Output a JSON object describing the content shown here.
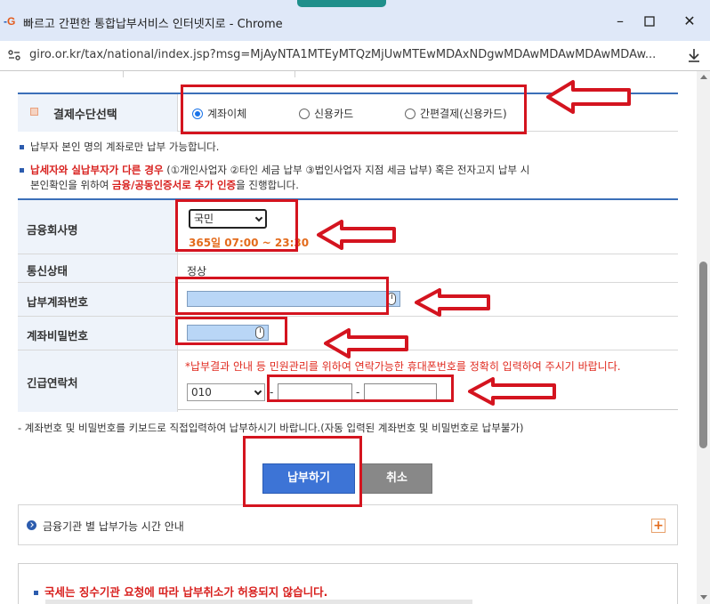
{
  "window": {
    "logo_g": "G",
    "title": "빠르고 간편한 통합납부서비스 인터넷지로 - Chrome",
    "url": "giro.or.kr/tax/national/index.jsp?msg=MjAyNTA1MTEyMTQzMjUwMTEwMDAxNDgwMDAwMDAwMDAwMDAw..."
  },
  "payment_method": {
    "label": "결제수단선택",
    "options": [
      {
        "label": "계좌이체",
        "selected": true
      },
      {
        "label": "신용카드",
        "selected": false
      },
      {
        "label": "간편결제(신용카드)",
        "selected": false
      }
    ]
  },
  "notes": {
    "own_account": "납부자 본인 명의 계좌로만 납부 가능합니다.",
    "diff_payer_red": "납세자와 실납부자가 다른 경우",
    "diff_payer_rest": " (①개인사업자 ②타인 세금 납부 ③법인사업자 지점 세금 납부) 혹은 전자고지 납부 시",
    "verify_pre": "본인확인을 위하여 ",
    "verify_bold": "금융/공동인증서로 추가 인증",
    "verify_post": "을 진행합니다.",
    "keyboard": "- 계좌번호 및 비밀번호를 키보드로 직접입력하여 납부하시기 바랍니다.(자동 입력된 계좌번호 및 비밀번호로 납부불가)"
  },
  "form": {
    "bank_label": "금융회사명",
    "bank_selected": "국민",
    "bank_hours": "365일 07:00 ~ 23:30",
    "comm_label": "통신상태",
    "comm_value": "정상",
    "account_label": "납부계좌번호",
    "password_label": "계좌비밀번호",
    "phone_label": "긴급연락처",
    "phone_note": "*납부결과 안내 등 민원관리를 위하여 연락가능한 휴대폰번호를 정확히 입력하여 주시기 바랍니다.",
    "phone_prefix": "010",
    "dash": "-"
  },
  "buttons": {
    "pay": "납부하기",
    "cancel": "취소"
  },
  "info": {
    "hours_guide": "금융기관 별 납부가능 시간 안내",
    "plus": "+"
  },
  "bottom": {
    "notice": "국세는 징수기관 요청에 따라 납부취소가 허용되지 않습니다."
  },
  "colors": {
    "annotation_red": "#d4141f",
    "primary_blue": "#3d74d6",
    "hours_orange": "#e36b1c"
  }
}
